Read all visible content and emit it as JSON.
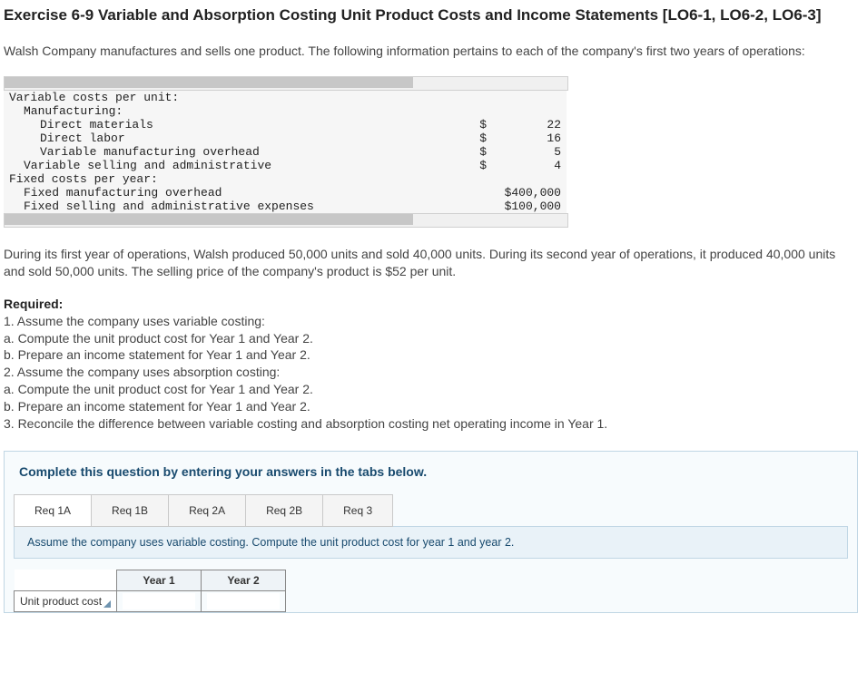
{
  "title": "Exercise 6-9 Variable and Absorption Costing Unit Product Costs and Income Statements [LO6-1, LO6-2, LO6-3]",
  "intro": "Walsh Company manufactures and sells one product. The following information pertains to each of the company's first two years of operations:",
  "costs": {
    "h_var": "Variable costs per unit:",
    "h_mfg": "Manufacturing:",
    "dm_label": "Direct materials",
    "dm_sym": "$",
    "dm_val": "22",
    "dl_label": "Direct labor",
    "dl_sym": "$",
    "dl_val": "16",
    "vmo_label": "Variable manufacturing overhead",
    "vmo_sym": "$",
    "vmo_val": "5",
    "vsa_label": "Variable selling and administrative",
    "vsa_sym": "$",
    "vsa_val": "4",
    "h_fix": "Fixed costs per year:",
    "fmo_label": "Fixed manufacturing overhead",
    "fmo_val": "$400,000",
    "fsa_label": "Fixed selling and administrative expenses",
    "fsa_val": "$100,000"
  },
  "mid": "During its first year of operations, Walsh produced 50,000 units and sold 40,000 units. During its second year of operations, it produced 40,000 units and sold 50,000 units. The selling price of the company's product is $52 per unit.",
  "required": {
    "head": "Required:",
    "l1": "1. Assume the company uses variable costing:",
    "l1a": "a. Compute the unit product cost for Year 1 and Year 2.",
    "l1b": "b. Prepare an income statement for Year 1 and Year 2.",
    "l2": "2. Assume the company uses absorption costing:",
    "l2a": "a. Compute the unit product cost for Year 1 and Year 2.",
    "l2b": "b. Prepare an income statement for Year 1 and Year 2.",
    "l3": "3. Reconcile the difference between variable costing and absorption costing net operating income in Year 1."
  },
  "answer": {
    "instr": "Complete this question by entering your answers in the tabs below.",
    "tabs": [
      "Req 1A",
      "Req 1B",
      "Req 2A",
      "Req 2B",
      "Req 3"
    ],
    "sub": "Assume the company uses variable costing. Compute the unit product cost for year 1 and year 2.",
    "col1": "Year 1",
    "col2": "Year 2",
    "row_label": "Unit product cost"
  }
}
